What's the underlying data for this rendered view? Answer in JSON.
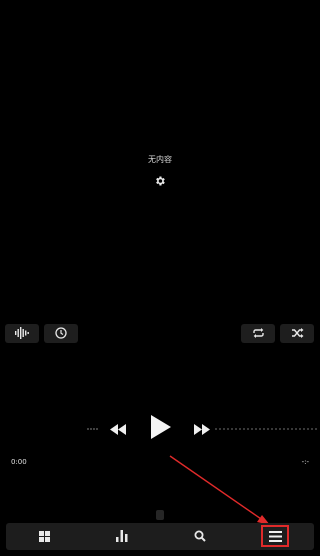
{
  "content": {
    "empty_label": "无内容"
  },
  "icons": {
    "settings": "gear-icon",
    "waveform": "waveform-icon",
    "timer": "clock-icon",
    "repeat": "repeat-icon",
    "shuffle": "shuffle-icon",
    "rewind": "rewind-icon",
    "play": "play-icon",
    "forward": "fast-forward-icon",
    "nav_grid": "grid-icon",
    "nav_stats": "bar-chart-icon",
    "nav_search": "search-icon",
    "nav_menu": "menu-icon"
  },
  "player": {
    "elapsed": "0:00",
    "remaining": "-:-"
  },
  "annotation": {
    "color": "#e02a2a"
  },
  "colors": {
    "background": "#000000",
    "panel": "#1e1e1e",
    "icon": "#e8e8e8"
  }
}
